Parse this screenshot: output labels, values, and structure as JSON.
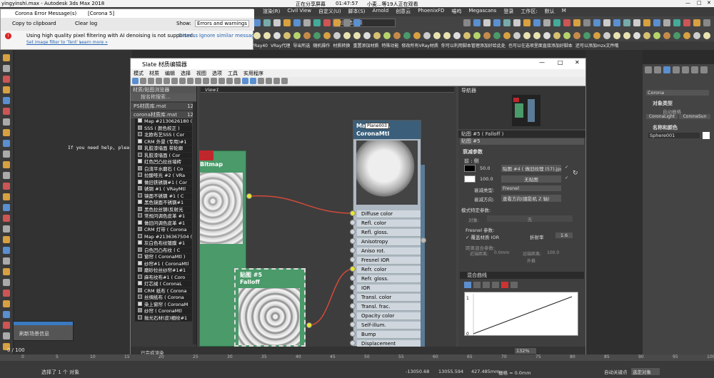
{
  "app": {
    "window_title": "yingyinshi.max - Autodesk 3ds Max 2018",
    "window_controls": [
      "—",
      "□",
      "✕"
    ]
  },
  "screen_share": {
    "label": "正在分享屏幕",
    "time": "01:47:57",
    "viewers": "小麦...等19人正在观看"
  },
  "main_menu": [
    "渲染(R)",
    "Civil View",
    "自定义(U)",
    "脚本(S)",
    "Arnold",
    "创意云",
    "PhoenixFD",
    "喵呜",
    "Megascans",
    "登录",
    "工作区:",
    "默认",
    "M"
  ],
  "selection_set": "创建选择集",
  "error_window": {
    "title": "Corona Error Message(s)",
    "tag": "[Corona 5]",
    "copy_label": "Copy to clipboard",
    "clear_label": "Clear log",
    "show_label": "Show:",
    "show_value": "Errors and warnings",
    "message": "Using high quality pixel filtering with AI denoising is not supported.",
    "dismiss": "Dismiss",
    "ignore": "Ignore similar messages",
    "link1": "Set image filter to 'Tent' »",
    "link2": "Learn more »"
  },
  "ribbon_items": [
    "英文VRay40",
    "VRay代理",
    "导出所选",
    "随机操作",
    "材质转换",
    "重置添加材质",
    "特殊功能",
    "修改所有VRay材质",
    "你可以利用脚本管理添加好给此处",
    "也可以在选项里面直接添加好脚本",
    "还可以添加mzx文件哦"
  ],
  "viewport_text": "If you need help, please vis",
  "slate": {
    "title": "Slate 材质编辑器",
    "menu": [
      "模式",
      "材质",
      "编辑",
      "选择",
      "视图",
      "选项",
      "工具",
      "实用程序"
    ],
    "view_tab": "View1",
    "browser_title": "材质/贴图浏览器",
    "search_placeholder": "按名称搜索...",
    "groups": [
      "PS材质库.mat",
      "corona材质库.mat"
    ],
    "group_counts": [
      "12",
      "12"
    ],
    "items": [
      "Map #2130626180 ( Corona",
      "SSS ( 颜色校正 )",
      "北欧布艺SSS ( Cor",
      "CRM 外景 (专用)#1",
      "乳胶漆墙面 带轮廓",
      "乳胶漆墙面 ( Cor",
      "红色凹凸拉丝墙砖",
      "白流平水磨石 ( Co",
      "拉酸哑光 #2 ( VRa",
      "做旧铁锈钢#1 ( Cor",
      "锈铜 #1 ( VRayMtl",
      "镜面不锈钢 #1 ( C",
      "黑色镜面不锈钢#1",
      "黑色拉丝钢(反射光",
      "常规问调色皮革 #1",
      "做旧问调色皮革 #1",
      "CRM 灯带 ( Corona",
      "Map #2136367504 ( C",
      "灰白色布纹镀膜 #1",
      "白色凹凸布纹 ( C",
      "窗帘 ( CoronaMtl )",
      "纱帘#1 ( CoronaMtl",
      "磨砂拉丝纱帘#1#1",
      "麻布纹布#1 ( Coro",
      "灯芯绒 ( CoronaL",
      "CRM 纸布 ( Corona",
      "丝绸纸布 ( Corona",
      "染上窗帘 ( CoronaM",
      "纱帘 ( CoronaMtl",
      "抛光石材(皮)细纹#1"
    ],
    "bitmap_node": "Bitmap",
    "falloff_node": {
      "title": "贴图 #5",
      "subtitle": "Falloff"
    },
    "mtl_node": {
      "title": "Ma 1474...",
      "subtitle": "CoronaMtl",
      "tooltip": "Plane003"
    },
    "slots": [
      "Diffuse color",
      "Refl. color",
      "Refl. gloss.",
      "Anisotropy",
      "Aniso rot.",
      "Fresnel IOR",
      "Refr. color",
      "Refr. gloss.",
      "IOR",
      "Transl. color",
      "Transl. frac.",
      "Opacity color",
      "Self-illum.",
      "Bump",
      "Displacement"
    ],
    "navigator_title": "导航器",
    "params_title": "贴图 #5 ( Falloff )",
    "params_name": "贴图 #5",
    "falloff_params": {
      "rollout": "衰减参数",
      "front_side": "前 : 侧",
      "val1": "50.0",
      "map1": "贴图 #4 ( 做旧纹理 (57).jpg )",
      "val2": "100.0",
      "map2": "无贴图",
      "falloff_type_label": "衰减类型:",
      "falloff_type": "Fresnel",
      "falloff_dir_label": "衰减方向:",
      "falloff_dir": "查看方向(摄影机 Z 轴)"
    },
    "mode_params": {
      "title": "模式特定参数:",
      "object_label": "对象:",
      "object_value": "无",
      "fresnel_label": "Fresnel 参数:",
      "override_label": "✓ 覆盖材质 IOR",
      "ior_label": "折射率",
      "ior_value": "1.6",
      "distance_label": "距离混合参数:",
      "near_label": "近端距离:",
      "near_value": "0.0mm",
      "far_label": "远端距离:",
      "far_value": "100.0",
      "extrap_label": "外推"
    },
    "curve_title": "混合曲线",
    "status": "已完成渲染",
    "zoom": "132%"
  },
  "command_panel": {
    "renderer": "Corona",
    "object_type": "对象类型",
    "auto_grid": "自动栅格",
    "btn1": "CoronaLight",
    "btn2": "CoronaSun",
    "name_color": "名称和颜色",
    "object_name": "Sphere001"
  },
  "status": {
    "notice": "刷新场景信息",
    "frame": "0 / 100",
    "selected": "选择了 1 个 对象",
    "x": "-13050.68",
    "y": "13055.594",
    "z": "427.485mm",
    "grid": "栅格 = 0.0mm",
    "key": "自动关键点",
    "sel_obj": "选定对象",
    "timeline_ticks": [
      "0",
      "5",
      "10",
      "15",
      "20",
      "25",
      "30",
      "35",
      "40",
      "45",
      "50",
      "55",
      "60",
      "65",
      "70",
      "75",
      "80",
      "85",
      "90",
      "95",
      "100"
    ]
  },
  "colors": {
    "node_green": "#4a9a6a",
    "mtl_header": "#3b5f7a",
    "wire_red": "#d24a3a",
    "socket_yellow": "#e8e830"
  }
}
